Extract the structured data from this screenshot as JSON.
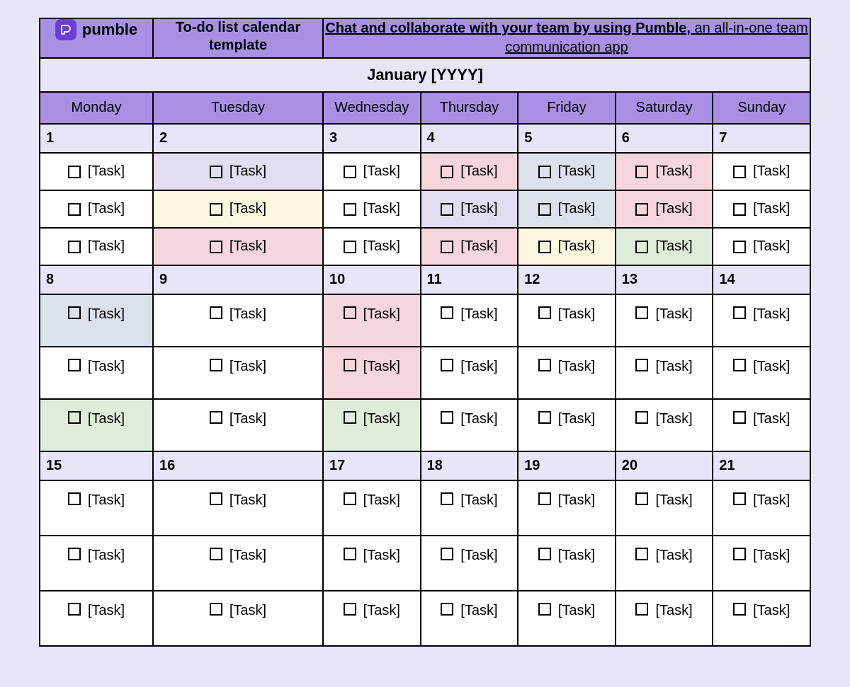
{
  "brand": {
    "name": "pumble"
  },
  "header": {
    "template_title": "To-do list  calendar template",
    "promo_bold": "Chat and collaborate with your team by using Pumble,",
    "promo_rest": " an all-in-one team communication app"
  },
  "month_title": "January [YYYY]",
  "days_of_week": [
    "Monday",
    "Tuesday",
    "Wednesday",
    "Thursday",
    "Friday",
    "Saturday",
    "Sunday"
  ],
  "task_placeholder": "[Task]",
  "colors": {
    "lavender": "#E4DCF1",
    "cream": "#FBF7E1",
    "pink": "#F4D6DC",
    "blue": "#DCE2EC",
    "green": "#DFECD9",
    "white": "#FFFFFF"
  },
  "weeks": [
    {
      "dates": [
        "1",
        "2",
        "3",
        "4",
        "5",
        "6",
        "7"
      ],
      "task_rows": [
        {
          "cells": [
            {
              "hl": ""
            },
            {
              "hl": "lav"
            },
            {
              "hl": ""
            },
            {
              "hl": "pink"
            },
            {
              "hl": "blue"
            },
            {
              "hl": "pink"
            },
            {
              "hl": ""
            }
          ]
        },
        {
          "cells": [
            {
              "hl": ""
            },
            {
              "hl": "crm"
            },
            {
              "hl": ""
            },
            {
              "hl": "lav"
            },
            {
              "hl": "blue"
            },
            {
              "hl": "pink"
            },
            {
              "hl": ""
            }
          ]
        },
        {
          "cells": [
            {
              "hl": ""
            },
            {
              "hl": "pink"
            },
            {
              "hl": ""
            },
            {
              "hl": "pink"
            },
            {
              "hl": "crm"
            },
            {
              "hl": "grn"
            },
            {
              "hl": ""
            }
          ]
        }
      ]
    },
    {
      "dates": [
        "8",
        "9",
        "10",
        "11",
        "12",
        "13",
        "14"
      ],
      "task_rows": [
        {
          "cells": [
            {
              "hl": "blue"
            },
            {
              "hl": ""
            },
            {
              "hl": "pink"
            },
            {
              "hl": ""
            },
            {
              "hl": ""
            },
            {
              "hl": ""
            },
            {
              "hl": ""
            }
          ]
        },
        {
          "cells": [
            {
              "hl": ""
            },
            {
              "hl": ""
            },
            {
              "hl": "pink"
            },
            {
              "hl": ""
            },
            {
              "hl": ""
            },
            {
              "hl": ""
            },
            {
              "hl": ""
            }
          ]
        },
        {
          "cells": [
            {
              "hl": "grn"
            },
            {
              "hl": ""
            },
            {
              "hl": "grn"
            },
            {
              "hl": ""
            },
            {
              "hl": ""
            },
            {
              "hl": ""
            },
            {
              "hl": ""
            }
          ]
        }
      ]
    },
    {
      "dates": [
        "15",
        "16",
        "17",
        "18",
        "19",
        "20",
        "21"
      ],
      "task_rows": [
        {
          "cells": [
            {
              "hl": ""
            },
            {
              "hl": ""
            },
            {
              "hl": ""
            },
            {
              "hl": ""
            },
            {
              "hl": ""
            },
            {
              "hl": ""
            },
            {
              "hl": ""
            }
          ]
        },
        {
          "cells": [
            {
              "hl": ""
            },
            {
              "hl": ""
            },
            {
              "hl": ""
            },
            {
              "hl": ""
            },
            {
              "hl": ""
            },
            {
              "hl": ""
            },
            {
              "hl": ""
            }
          ]
        },
        {
          "cells": [
            {
              "hl": ""
            },
            {
              "hl": ""
            },
            {
              "hl": ""
            },
            {
              "hl": ""
            },
            {
              "hl": ""
            },
            {
              "hl": ""
            },
            {
              "hl": ""
            }
          ]
        }
      ]
    }
  ]
}
